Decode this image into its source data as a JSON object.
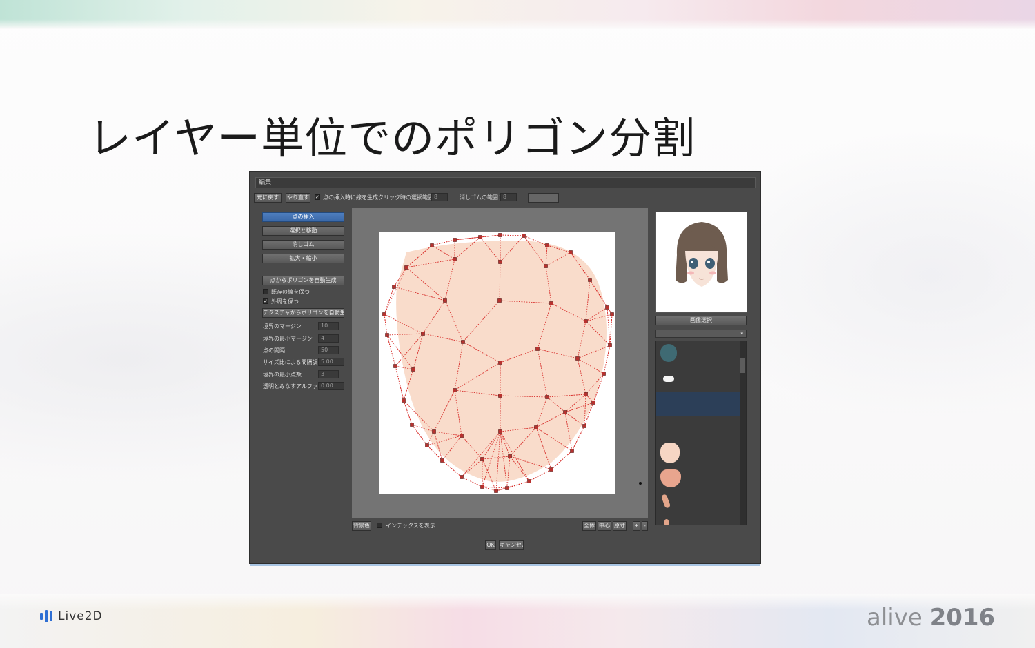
{
  "slide": {
    "title": "レイヤー単位でのポリゴン分割",
    "brand_text": "Live2D",
    "event_logo_light": "alive ",
    "event_logo_bold": "2016"
  },
  "editor": {
    "title": "編集",
    "toolbar": {
      "undo_label": "元に戻す",
      "redo_label": "やり直す",
      "auto_edge_label": "点の挿入時に線を生成",
      "auto_edge_checked": true,
      "click_range_label": "クリック時の選択範囲：",
      "click_range_value": "8",
      "eraser_range_label": "消しゴムの範囲：",
      "eraser_range_value": "8"
    },
    "tools": {
      "insert_point": "点の挿入",
      "select_move": "選択と移動",
      "eraser": "消しゴム",
      "zoom": "拡大・縮小"
    },
    "auto_gen": {
      "from_points_button": "点からポリゴンを自動生成",
      "keep_existing_label": "既存の線を保つ",
      "keep_existing_checked": false,
      "keep_outer_label": "外周を保つ",
      "keep_outer_checked": true,
      "from_texture_button": "テクスチャからポリゴンを自動生成"
    },
    "params": [
      {
        "label": "境界のマージン",
        "value": "10"
      },
      {
        "label": "境界の最小マージン",
        "value": "4"
      },
      {
        "label": "点の間隔",
        "value": "50"
      },
      {
        "label": "サイズ比による間隔調整",
        "value": "5.00"
      },
      {
        "label": "境界の最小点数",
        "value": "3"
      },
      {
        "label": "透明とみなすアルファ値",
        "value": "0.00"
      }
    ],
    "bottom_bar": {
      "bg_color_button": "背景色",
      "show_index_label": "インデックスを表示",
      "show_index_checked": false,
      "fit_all_button": "全体",
      "center_button": "中心",
      "actual_size_button": "原寸",
      "zoom_in_button": "+",
      "zoom_out_button": "-"
    },
    "image_select_button": "画像選択",
    "dropdown_arrow": "▾",
    "ok_button": "OK",
    "cancel_button": "キャンセル",
    "colors": {
      "mesh_fill": "#f9dccb",
      "mesh_line": "#d8322e",
      "vertex": "#b8322f",
      "active_tool": "#4a7bbd",
      "list_selected": "#2c3f58"
    }
  }
}
